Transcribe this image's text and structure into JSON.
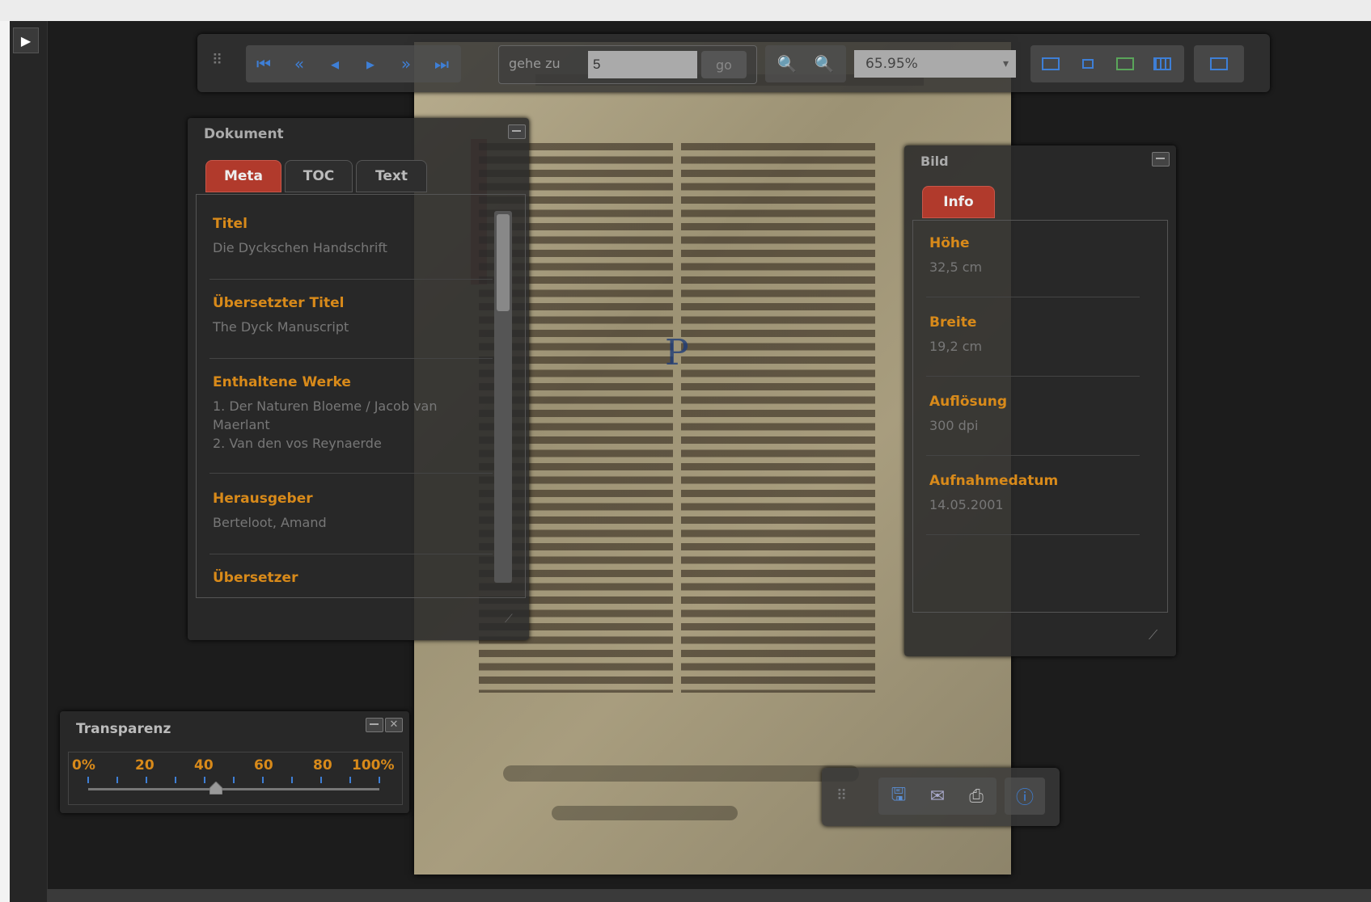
{
  "toolbar": {
    "navigation": [
      {
        "name": "first-page-icon",
        "glyph": "⏮"
      },
      {
        "name": "fast-back-icon",
        "glyph": "«"
      },
      {
        "name": "prev-page-icon",
        "glyph": "◂"
      },
      {
        "name": "next-page-icon",
        "glyph": "▸"
      },
      {
        "name": "fast-forward-icon",
        "glyph": "»"
      },
      {
        "name": "last-page-icon",
        "glyph": "⏭"
      }
    ],
    "goto_label": "gehe zu",
    "goto_value": "5",
    "go_label": "go",
    "zoom_out_glyph": "🔍",
    "zoom_in_glyph": "🔍",
    "zoom_value": "65.95%",
    "zoom_dropdown_glyph": "▾"
  },
  "dokument": {
    "title": "Dokument",
    "tabs": [
      "Meta",
      "TOC",
      "Text"
    ],
    "fields": [
      {
        "label": "Titel",
        "value": "Die Dyckschen Handschrift"
      },
      {
        "label": "Übersetzter Titel",
        "value": "The Dyck Manuscript"
      },
      {
        "label": "Enthaltene Werke",
        "value": "1. Der Naturen Bloeme / Jacob van Maerlant\n2. Van den vos Reynaerde"
      },
      {
        "label": "Herausgeber",
        "value": "Berteloot, Amand"
      },
      {
        "label": "Übersetzer",
        "value": ""
      }
    ]
  },
  "bild": {
    "title": "Bild",
    "tab": "Info",
    "fields": [
      {
        "label": "Höhe",
        "value": "32,5 cm"
      },
      {
        "label": "Breite",
        "value": "19,2 cm"
      },
      {
        "label": "Auflösung",
        "value": "300 dpi"
      },
      {
        "label": "Aufnahmedatum",
        "value": "14.05.2001"
      }
    ]
  },
  "transparenz": {
    "title": "Transparenz",
    "ticks": [
      "0%",
      "20",
      "40",
      "60",
      "80",
      "100%"
    ],
    "value_percent": 44
  },
  "bottom_toolbar": {
    "icons": [
      "save-icon",
      "mail-icon",
      "print-icon",
      "info-icon"
    ]
  },
  "colors": {
    "accent": "#d88a1a",
    "tab_active": "#b13a2c",
    "nav_blue": "#3e7fd6"
  }
}
